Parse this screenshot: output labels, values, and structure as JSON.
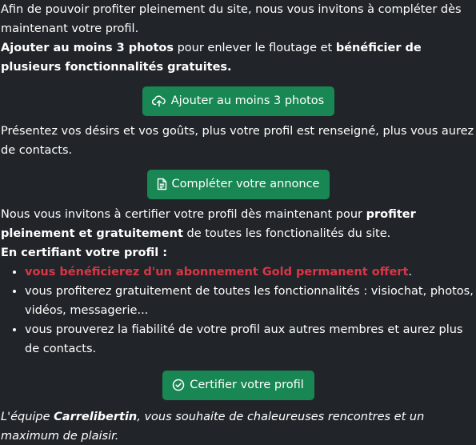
{
  "intro": {
    "line1": "Afin de pouvoir profiter pleinement du site, nous vous invitons à compléter dès maintenant votre profil.",
    "bold_a": "Ajouter au moins 3 photos",
    "mid": " pour enlever le floutage et ",
    "bold_b": "bénéficier de plusieurs fonctionnalités gratuites."
  },
  "buttons": {
    "photos": {
      "label": "Ajouter au moins 3 photos",
      "icon": "cloud-upload-icon"
    },
    "annonce": {
      "label": "Compléter votre annonce",
      "icon": "document-icon"
    },
    "certify": {
      "label": "Certifier votre profil",
      "icon": "check-circle-icon"
    }
  },
  "desires": {
    "text": "Présentez vos désirs et vos goûts, plus votre profil est renseigné, plus vous aurez de contacts."
  },
  "certify_section": {
    "pre": "Nous vous invitons à certifier votre profil dès maintenant pour ",
    "bold": "profiter pleinement et gratuitement",
    "post": " de toutes les fonctionalités du site.",
    "heading": "En certifiant votre profil :",
    "items": [
      {
        "text": "vous bénéficierez d'un abonnement Gold permanent offert",
        "suffix": "."
      },
      {
        "text": "vous profiterez gratuitement de toutes les fonctionnalités : visiochat, photos, vidéos, messagerie...",
        "suffix": ""
      },
      {
        "text": "vous prouverez la fiabilité de votre profil aux autres membres et aurez plus de contacts.",
        "suffix": ""
      }
    ]
  },
  "signature": {
    "pre": "L'équipe ",
    "brand": "Carrelibertin",
    "post": ", vous souhaite de chaleureuses rencontres et un maximum de plaisir."
  },
  "colors": {
    "background": "#212529",
    "button": "#198754",
    "highlight": "#dc3545"
  }
}
